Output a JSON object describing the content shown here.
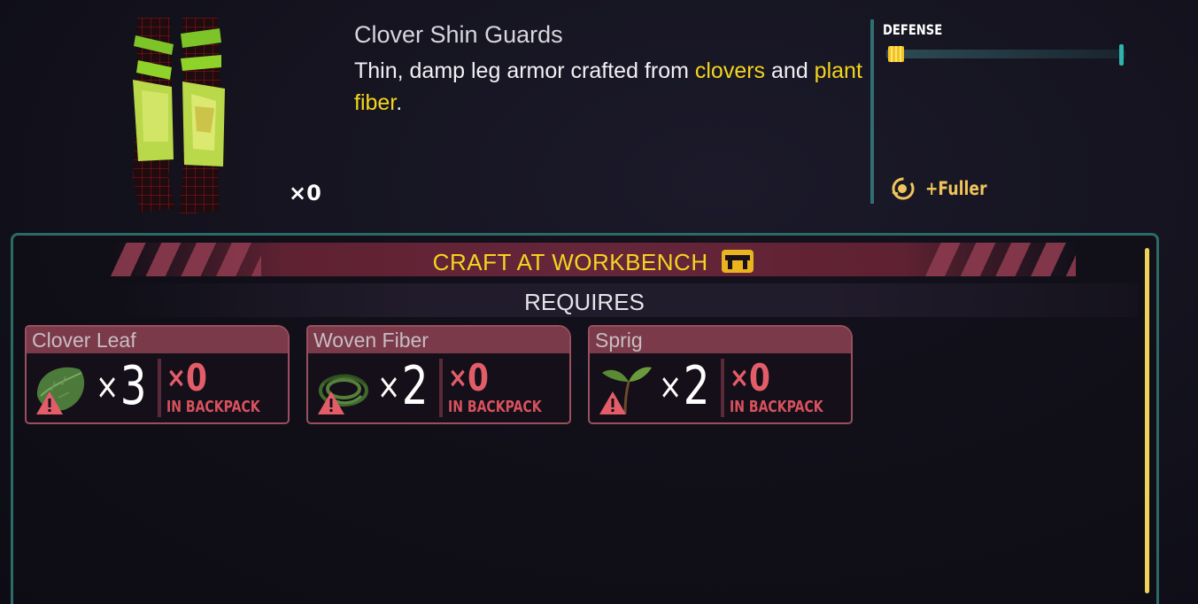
{
  "item": {
    "name": "Clover Shin Guards",
    "description_parts": [
      {
        "text": "Thin, damp leg armor crafted from ",
        "highlight": false
      },
      {
        "text": "clovers",
        "highlight": true
      },
      {
        "text": " and ",
        "highlight": false
      },
      {
        "text": "plant fiber",
        "highlight": true
      },
      {
        "text": ".",
        "highlight": false
      }
    ],
    "owned_count": "×0",
    "image_icon": "clover-shin-guards-icon"
  },
  "stats": {
    "label": "DEFENSE",
    "defense_level": 0.06,
    "effect_icon": "fuller-effect-icon",
    "effect_text": "+Fuller"
  },
  "craft": {
    "title": "CRAFT AT WORKBENCH",
    "station_icon": "workbench-icon",
    "requires_label": "REQUIRES",
    "ingredients": [
      {
        "name": "Clover Leaf",
        "icon": "clover-leaf-icon",
        "x": "×",
        "required": "3",
        "have_x": "×",
        "have": "0",
        "in_backpack": "IN BACKPACK"
      },
      {
        "name": "Woven Fiber",
        "icon": "woven-fiber-icon",
        "x": "×",
        "required": "2",
        "have_x": "×",
        "have": "0",
        "in_backpack": "IN BACKPACK"
      },
      {
        "name": "Sprig",
        "icon": "sprig-icon",
        "x": "×",
        "required": "2",
        "have_x": "×",
        "have": "0",
        "in_backpack": "IN BACKPACK"
      }
    ]
  },
  "colors": {
    "highlight": "#f3d51e",
    "panel_border": "#2c6a66",
    "card_header": "#7a3a4a",
    "missing": "#e35d69"
  }
}
